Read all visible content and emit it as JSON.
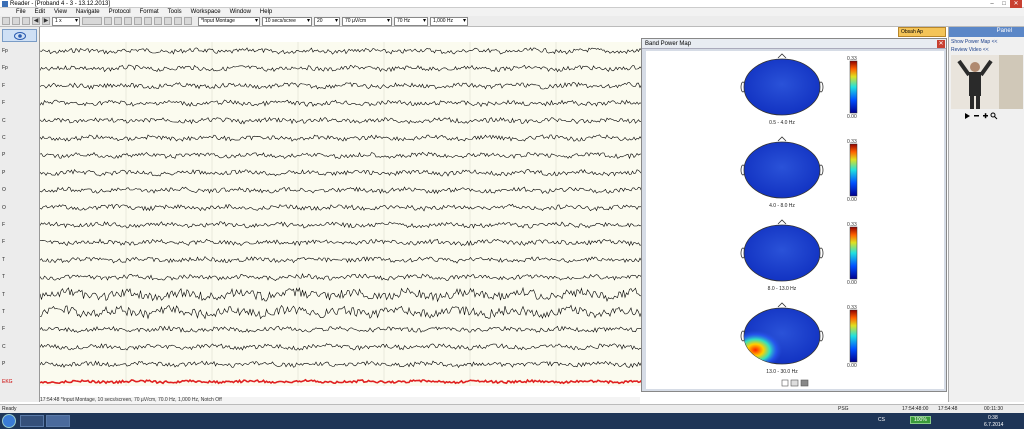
{
  "window": {
    "title": "Reader - [Proband 4 - 3 - 13.12.2013]",
    "minimize": "–",
    "maximize": "□",
    "close": "✕"
  },
  "menu": [
    "File",
    "Edit",
    "View",
    "Navigate",
    "Protocol",
    "Format",
    "Tools",
    "Workspace",
    "Window",
    "Help"
  ],
  "toolbar": {
    "speed": "1 x",
    "montage": "*Input Montage",
    "timebase": "10 secs/scree",
    "channels": "20",
    "sensitivity": "70 µV/cm",
    "lowpass": "70 Hz",
    "highpass": "1,000 Hz"
  },
  "channels": [
    "Fp",
    "Fp",
    "F",
    "F",
    "C",
    "C",
    "P",
    "P",
    "O",
    "O",
    "F",
    "F",
    "T",
    "T",
    "T",
    "T",
    "F",
    "C",
    "P",
    "EKG"
  ],
  "eeg_status": "17:54:48 *Input Montage, 10 secs/screen, 70 µV/cm, 70.0 Hz, 1,000 Hz, Notch Off",
  "status": {
    "ready": "Ready",
    "psg": "PSG",
    "t1": "17:54:48:00",
    "t2": "17:54:48",
    "t3": "00:11:30"
  },
  "popup": {
    "title": "Band Power Map",
    "colorbar_max": "0.33",
    "colorbar_min": "0.00",
    "bands": [
      "0.5 - 4.0 Hz",
      "4.0 - 8.0 Hz",
      "8.0 - 13.0 Hz",
      "13.0 - 30.0 Hz"
    ]
  },
  "obsah_button": "Obsah Ap",
  "panel": {
    "title": "Panel",
    "line1": "Show Power Map <<",
    "line2": "Review Video <<"
  },
  "taskbar": {
    "lang": "CS",
    "battery": "100%",
    "time": "0:38",
    "date": "6.7.2014"
  },
  "colors": {
    "eeg_trace": "#000000",
    "ekg_trace": "#e02020",
    "eeg_bg": "#fbfbef",
    "accent": "#5b87c7"
  }
}
